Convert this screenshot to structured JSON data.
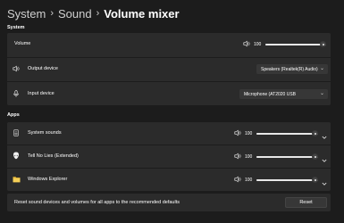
{
  "breadcrumb": {
    "level1": "System",
    "level2": "Sound",
    "current": "Volume mixer",
    "separator": "›"
  },
  "system_section": {
    "title": "System",
    "volume": {
      "label": "Volume",
      "value": "100",
      "level": 1.0
    },
    "output_device": {
      "label": "Output device",
      "selected": "Speakers (Realtek(R) Audio)"
    },
    "input_device": {
      "label": "Input device",
      "selected": "Microphone (AT2020 USB"
    }
  },
  "apps_section": {
    "title": "Apps",
    "apps": [
      {
        "name": "System sounds",
        "value": "100",
        "level": 1.0,
        "icon": "system-sounds-icon"
      },
      {
        "name": "Tell No Lies (Extended)",
        "value": "100",
        "level": 1.0,
        "icon": "app-alien-icon"
      },
      {
        "name": "Windows Explorer",
        "value": "100",
        "level": 1.0,
        "icon": "folder-icon"
      }
    ]
  },
  "reset": {
    "description": "Reset sound devices and volumes for all apps to the recommended defaults",
    "button_label": "Reset"
  },
  "colors": {
    "background": "#1c1c1c",
    "card": "#2b2b2b",
    "control": "#373737",
    "track_fill": "#e8e8e8",
    "folder": "#e8b93a"
  }
}
